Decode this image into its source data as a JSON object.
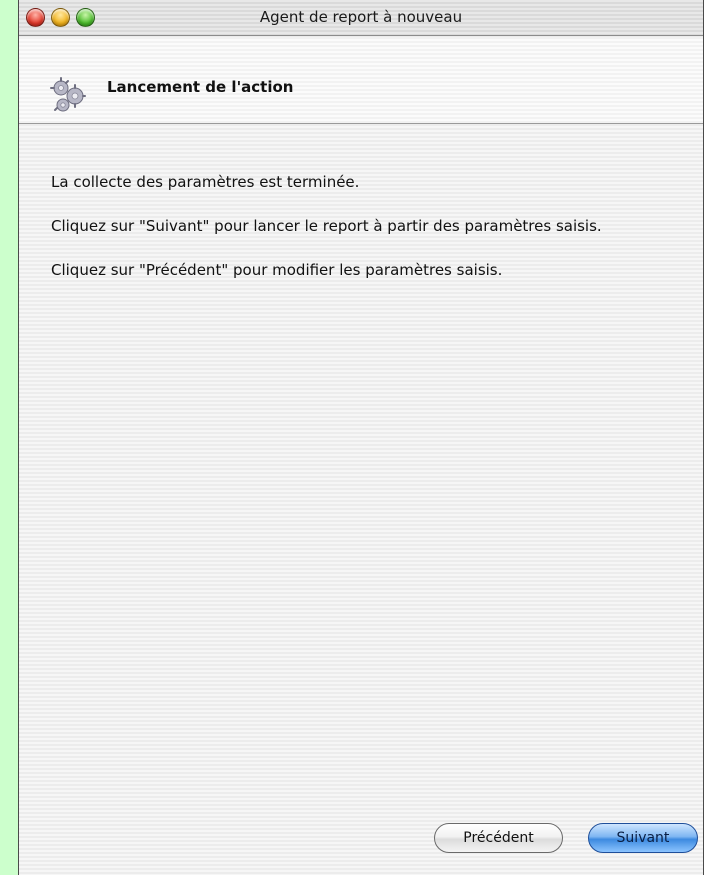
{
  "window": {
    "title": "Agent de report à nouveau"
  },
  "header": {
    "title": "Lancement de l'action",
    "icon": "gears-icon"
  },
  "body": {
    "paragraphs": [
      "La collecte des paramètres est terminée.",
      "Cliquez sur \"Suivant\" pour lancer le report à partir des paramètres saisis.",
      "Cliquez sur \"Précédent\" pour modifier les paramètres saisis."
    ]
  },
  "buttons": {
    "previous_label": "Précédent",
    "next_label": "Suivant"
  },
  "colors": {
    "background": "#ccffcc",
    "close": "#e23a2b",
    "minimize": "#f0b21c",
    "zoom": "#4cbc2c",
    "default_button": "#3d8ae0"
  }
}
